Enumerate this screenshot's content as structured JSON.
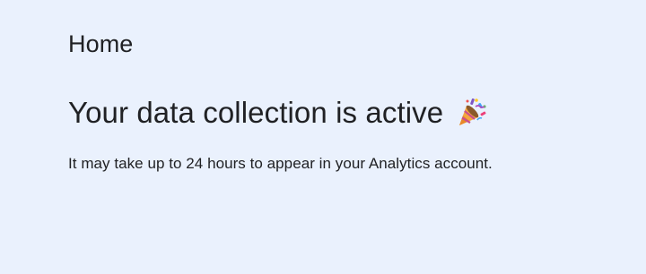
{
  "page": {
    "title": "Home"
  },
  "status_card": {
    "headline": "Your data collection is active",
    "icon": "party-popper-icon",
    "description": "It may take up to 24 hours to appear in your Analytics account."
  },
  "colors": {
    "background": "#eaf1fd",
    "text": "#202124"
  }
}
